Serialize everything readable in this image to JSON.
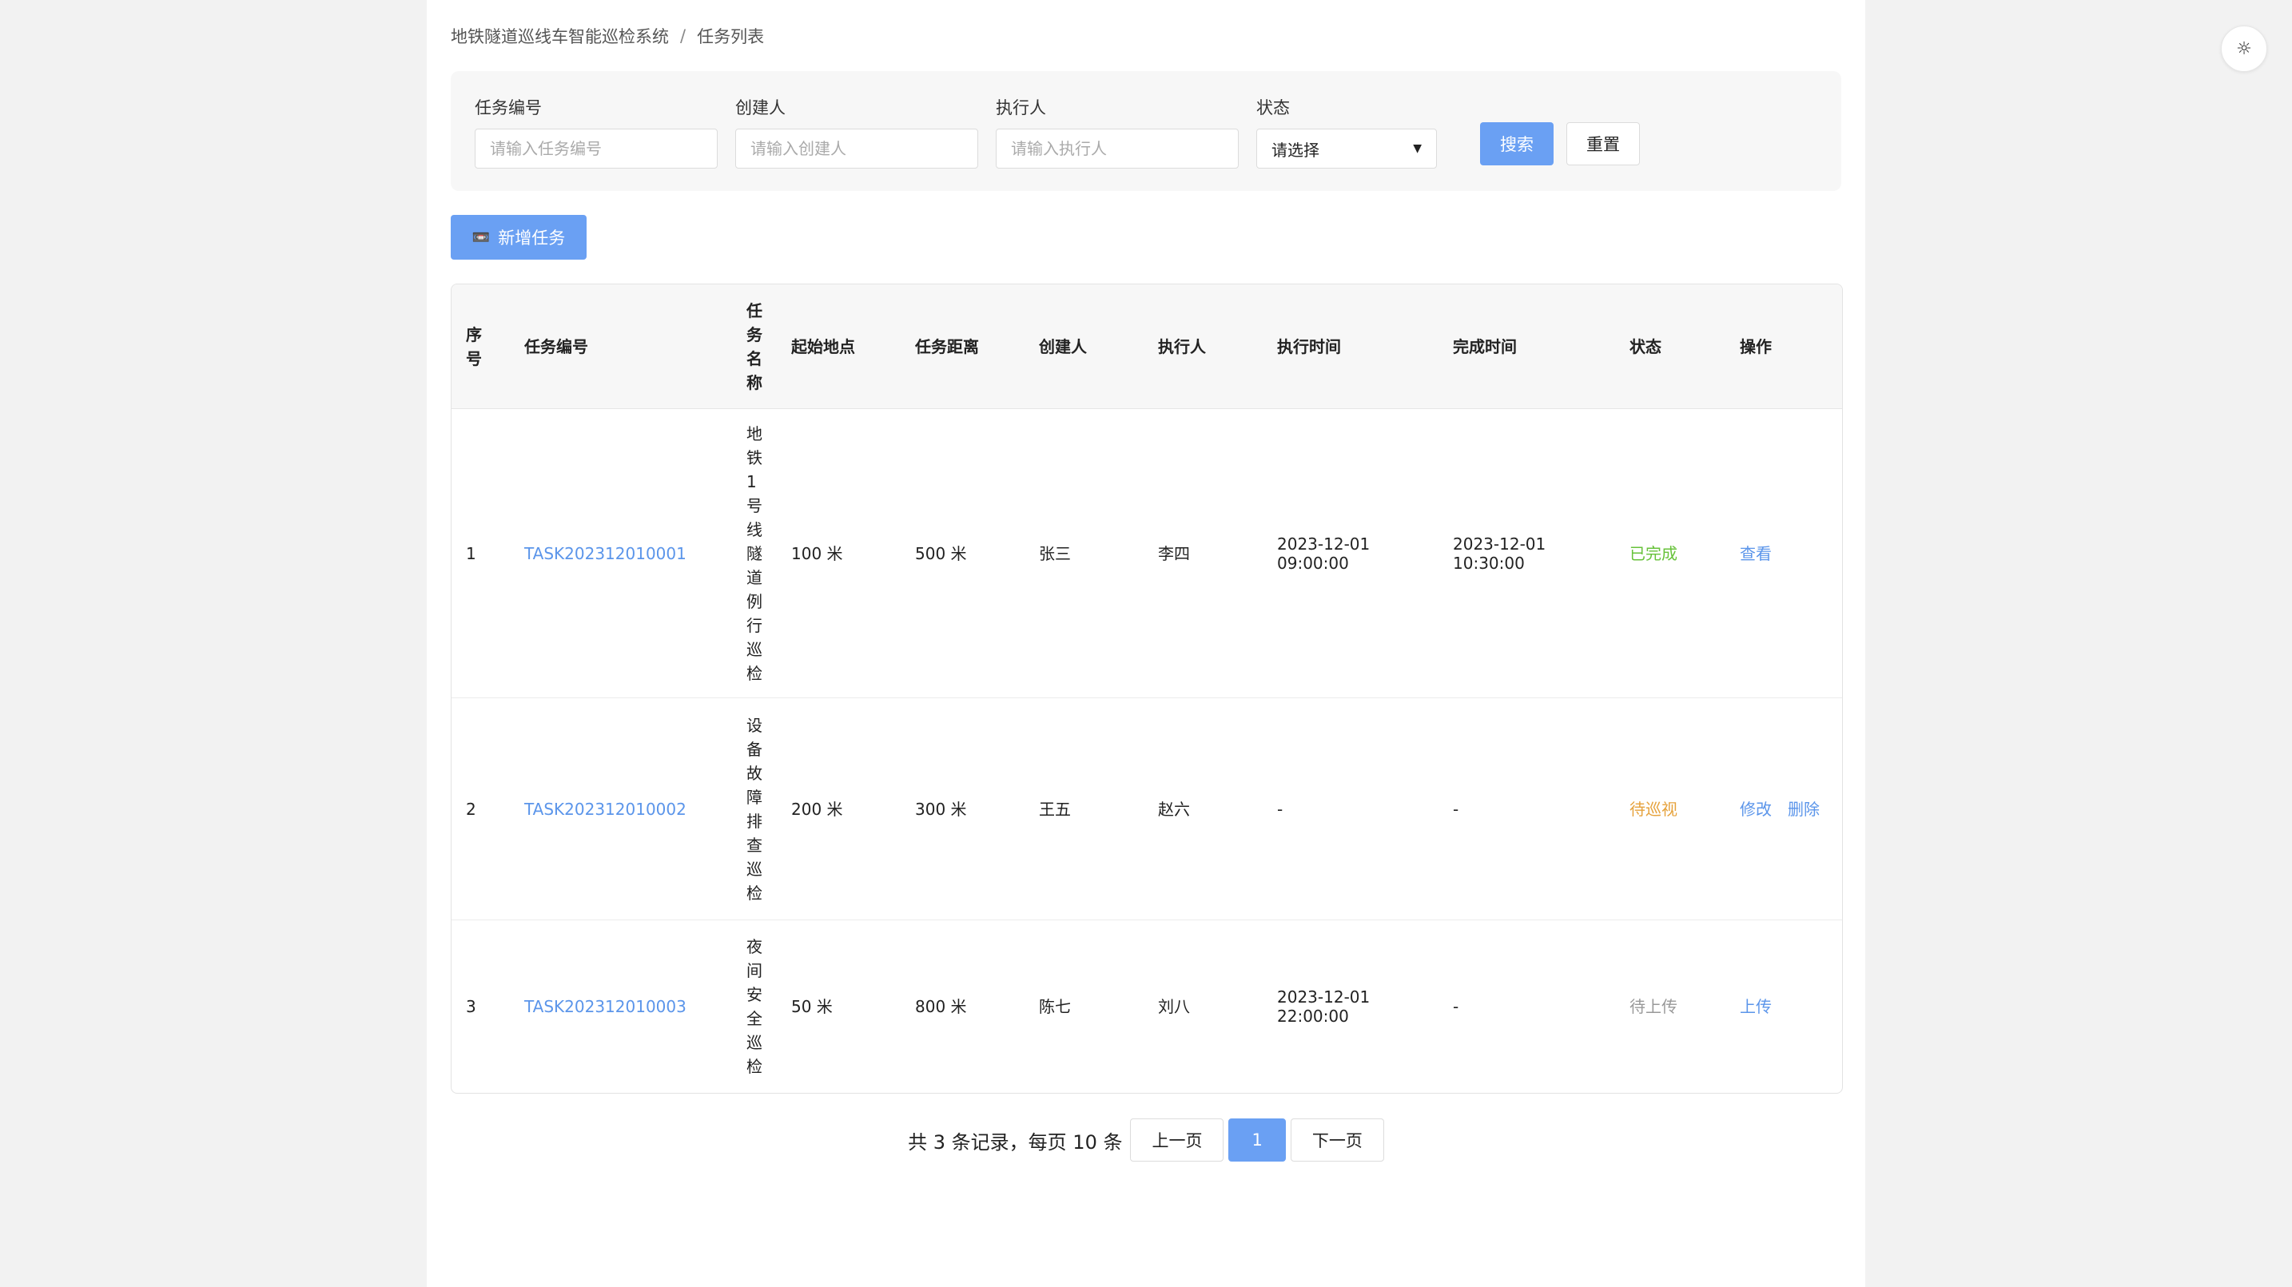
{
  "breadcrumb": {
    "root": "地铁隧道巡线车智能巡检系统",
    "separator": "/",
    "current": "任务列表"
  },
  "theme_toggle": {
    "icon": "☼"
  },
  "filters": {
    "task_no": {
      "label": "任务编号",
      "placeholder": "请输入任务编号"
    },
    "creator": {
      "label": "创建人",
      "placeholder": "请输入创建人"
    },
    "executor": {
      "label": "执行人",
      "placeholder": "请输入执行人"
    },
    "status": {
      "label": "状态",
      "value": "请选择"
    },
    "search_label": "搜索",
    "reset_label": "重置"
  },
  "add_button": {
    "label": "新增任务",
    "icon": "📼"
  },
  "table": {
    "headers": [
      "序号",
      "任务编号",
      "任务名称",
      "起始地点",
      "任务距离",
      "创建人",
      "执行人",
      "执行时间",
      "完成时间",
      "状态",
      "操作"
    ],
    "rows": [
      {
        "index": "1",
        "task_no": "TASK202312010001",
        "name": "地铁1号线隧道例行巡检",
        "start": "100 米",
        "distance": "500 米",
        "creator": "张三",
        "executor": "李四",
        "exec_time": "2023-12-01 09:00:00",
        "finish_time": "2023-12-01 10:30:00",
        "status": "已完成",
        "actions": [
          "查看"
        ]
      },
      {
        "index": "2",
        "task_no": "TASK202312010002",
        "name": "设备故障排查巡检",
        "start": "200 米",
        "distance": "300 米",
        "creator": "王五",
        "executor": "赵六",
        "exec_time": "-",
        "finish_time": "-",
        "status": "待巡视",
        "actions": [
          "修改",
          "删除"
        ]
      },
      {
        "index": "3",
        "task_no": "TASK202312010003",
        "name": "夜间安全巡检",
        "start": "50 米",
        "distance": "800 米",
        "creator": "陈七",
        "executor": "刘八",
        "exec_time": "2023-12-01 22:00:00",
        "finish_time": "-",
        "status": "待上传",
        "actions": [
          "上传"
        ]
      }
    ]
  },
  "pagination": {
    "summary": "共 3 条记录，每页 10 条",
    "prev": "上一页",
    "current": "1",
    "next": "下一页"
  },
  "colors": {
    "primary": "#6aa0f3",
    "link": "#5b95ea",
    "done": "#67c23a",
    "pending": "#e6a23c",
    "upload": "#999999"
  }
}
